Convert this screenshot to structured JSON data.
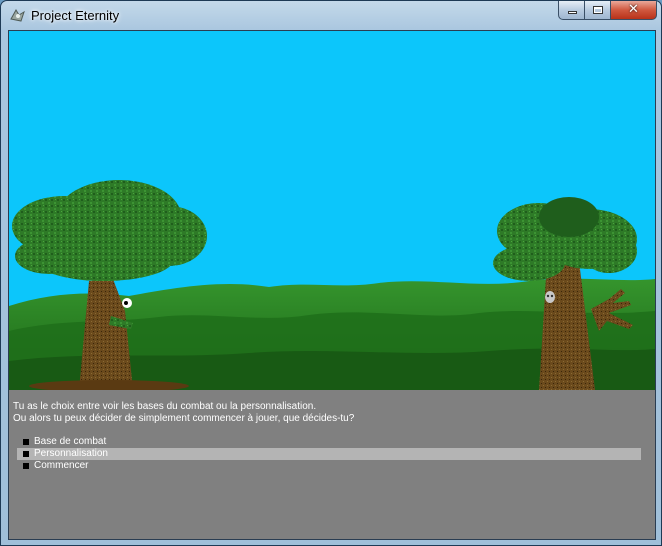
{
  "window": {
    "title": "Project Eternity",
    "icon": "app-icon",
    "controls": {
      "minimize_icon": "minimize-icon",
      "maximize_icon": "maximize-icon",
      "close_icon": "close-icon",
      "close_glyph": "✕"
    }
  },
  "dialog": {
    "lines": [
      "Tu as le choix entre voir les bases du combat ou la personnalisation.",
      "Ou alors tu peux décider de simplement commencer à jouer, que décides-tu?"
    ],
    "options": [
      {
        "label": "Base de combat",
        "selected": false
      },
      {
        "label": "Personnalisation",
        "selected": true
      },
      {
        "label": "Commencer",
        "selected": false
      }
    ]
  },
  "colors": {
    "sky": "#0cc6fb",
    "dialog_bg": "#808080",
    "selection": "#b4b4b4",
    "foliage": "#2f7d2a"
  }
}
